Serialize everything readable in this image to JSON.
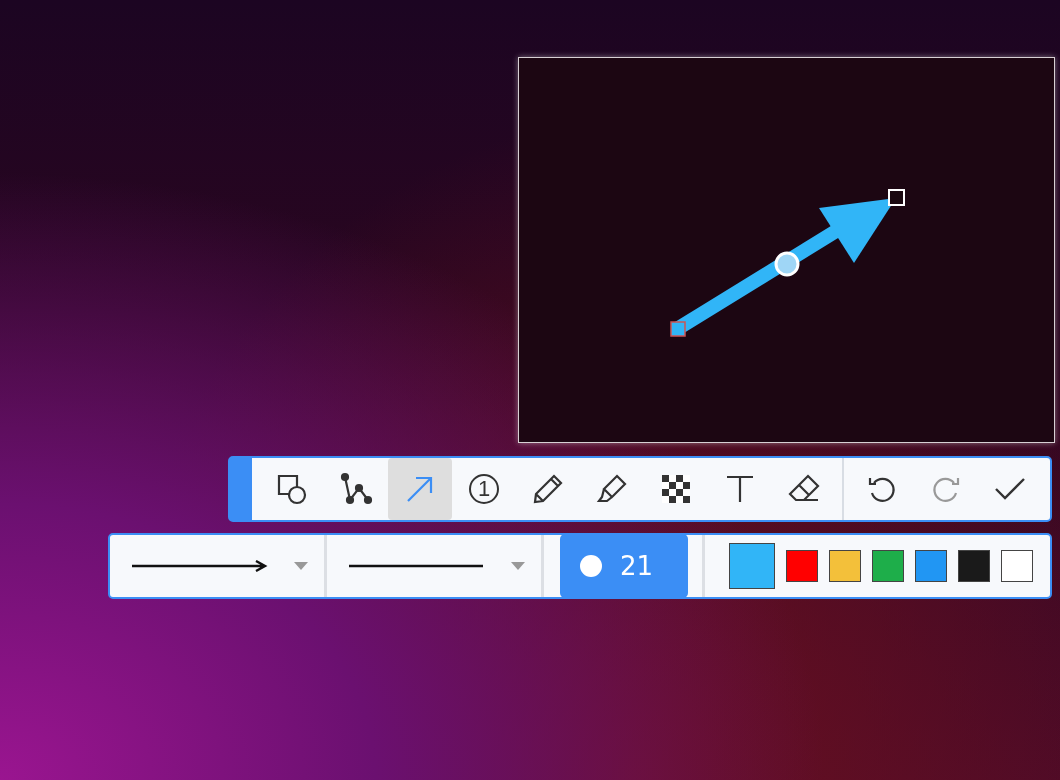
{
  "tools": [
    {
      "kind": "shape",
      "selected": false
    },
    {
      "kind": "polyline",
      "selected": false
    },
    {
      "kind": "arrow",
      "selected": true
    },
    {
      "kind": "number",
      "selected": false,
      "label": "1"
    },
    {
      "kind": "pencil",
      "selected": false
    },
    {
      "kind": "highlighter",
      "selected": false
    },
    {
      "kind": "mosaic",
      "selected": false
    },
    {
      "kind": "text",
      "selected": false
    },
    {
      "kind": "eraser",
      "selected": false
    }
  ],
  "actions": [
    {
      "kind": "undo",
      "disabled": false
    },
    {
      "kind": "redo",
      "disabled": true
    },
    {
      "kind": "confirm",
      "disabled": false
    }
  ],
  "line_styles": [
    {
      "kind": "arrow"
    },
    {
      "kind": "line"
    }
  ],
  "size": {
    "value": "21"
  },
  "colors": [
    {
      "color": "#31b5f7",
      "selected": true
    },
    {
      "color": "#ff0000",
      "selected": false
    },
    {
      "color": "#f3c03a",
      "selected": false
    },
    {
      "color": "#1eae4a",
      "selected": false
    },
    {
      "color": "#2196f3",
      "selected": false
    },
    {
      "color": "#1a1a1a",
      "selected": false
    },
    {
      "color": "#ffffff",
      "selected": false
    }
  ]
}
